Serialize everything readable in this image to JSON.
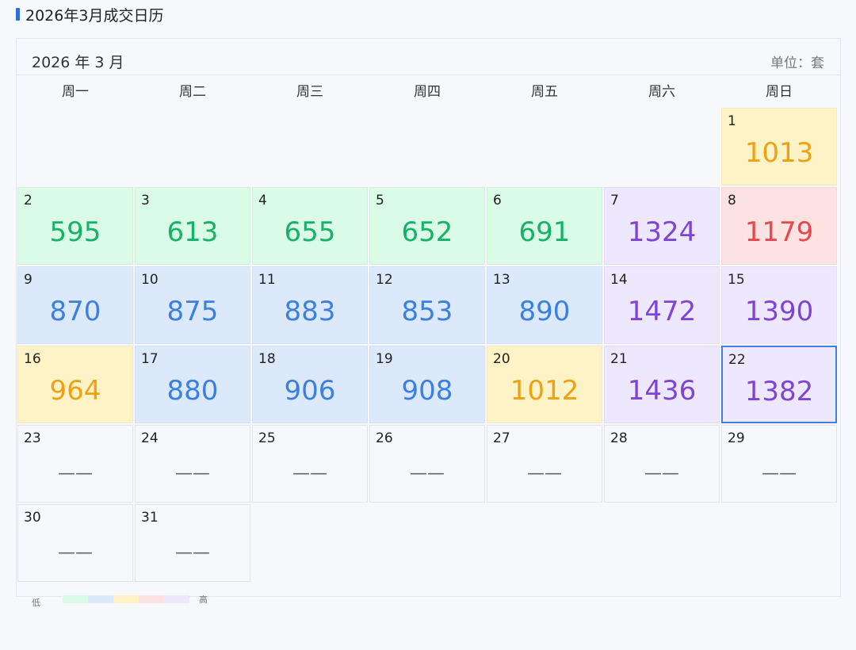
{
  "page_title": "2026年3月成交日历",
  "calendar": {
    "month_label": "2026 年 3 月",
    "unit_label": "单位：套",
    "weekdays": [
      "周一",
      "周二",
      "周三",
      "周四",
      "周五",
      "周六",
      "周日"
    ],
    "leading_blanks": 6,
    "days": [
      {
        "day": "1",
        "value": "1013",
        "level": "yellow"
      },
      {
        "day": "2",
        "value": "595",
        "level": "green"
      },
      {
        "day": "3",
        "value": "613",
        "level": "green"
      },
      {
        "day": "4",
        "value": "655",
        "level": "green"
      },
      {
        "day": "5",
        "value": "652",
        "level": "green"
      },
      {
        "day": "6",
        "value": "691",
        "level": "green"
      },
      {
        "day": "7",
        "value": "1324",
        "level": "purple"
      },
      {
        "day": "8",
        "value": "1179",
        "level": "red"
      },
      {
        "day": "9",
        "value": "870",
        "level": "blue"
      },
      {
        "day": "10",
        "value": "875",
        "level": "blue"
      },
      {
        "day": "11",
        "value": "883",
        "level": "blue"
      },
      {
        "day": "12",
        "value": "853",
        "level": "blue"
      },
      {
        "day": "13",
        "value": "890",
        "level": "blue"
      },
      {
        "day": "14",
        "value": "1472",
        "level": "purple"
      },
      {
        "day": "15",
        "value": "1390",
        "level": "purple"
      },
      {
        "day": "16",
        "value": "964",
        "level": "yellow"
      },
      {
        "day": "17",
        "value": "880",
        "level": "blue"
      },
      {
        "day": "18",
        "value": "906",
        "level": "blue"
      },
      {
        "day": "19",
        "value": "908",
        "level": "blue"
      },
      {
        "day": "20",
        "value": "1012",
        "level": "yellow"
      },
      {
        "day": "21",
        "value": "1436",
        "level": "purple"
      },
      {
        "day": "22",
        "value": "1382",
        "level": "purple",
        "today": true
      },
      {
        "day": "23",
        "value": "——",
        "level": "empty"
      },
      {
        "day": "24",
        "value": "——",
        "level": "empty"
      },
      {
        "day": "25",
        "value": "——",
        "level": "empty"
      },
      {
        "day": "26",
        "value": "——",
        "level": "empty"
      },
      {
        "day": "27",
        "value": "——",
        "level": "empty"
      },
      {
        "day": "28",
        "value": "——",
        "level": "empty"
      },
      {
        "day": "29",
        "value": "——",
        "level": "empty"
      },
      {
        "day": "30",
        "value": "——",
        "level": "empty"
      },
      {
        "day": "31",
        "value": "——",
        "level": "empty"
      }
    ]
  },
  "legend": {
    "low_label": "低",
    "high_label": "高",
    "swatches": [
      "#dafbe6",
      "#dbe9fb",
      "#fef3c7",
      "#fde2e2",
      "#ede8fd"
    ]
  }
}
